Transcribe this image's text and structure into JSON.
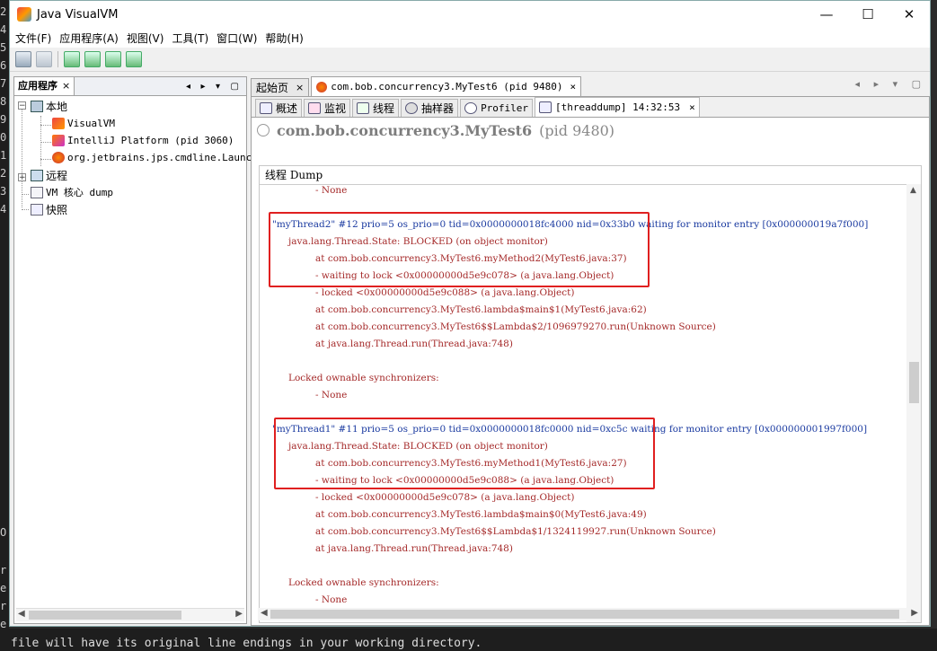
{
  "background": {
    "terminal_chars": [
      "2",
      "4",
      "5",
      "6",
      "7",
      "8",
      "9",
      "0",
      "1",
      "2",
      "3",
      "4",
      "O",
      "r",
      "e",
      "r",
      "e",
      "r"
    ],
    "bottom_text": "file will have its original line endings in your working directory."
  },
  "window": {
    "title": "Java VisualVM",
    "controls": {
      "minimize": "—",
      "maximize": "☐",
      "close": "✕"
    }
  },
  "menu": [
    "文件(F)",
    "应用程序(A)",
    "视图(V)",
    "工具(T)",
    "窗口(W)",
    "帮助(H)"
  ],
  "left_panel": {
    "tab_label": "应用程序",
    "tab_close": "×",
    "controls": "◂ ▸ ▾ ▢",
    "tree": {
      "local": "本地",
      "visualvm": "VisualVM",
      "intellij": "IntelliJ Platform (pid 3060)",
      "launcher": "org.jetbrains.jps.cmdline.Launcher",
      "remote": "远程",
      "core_dump": "VM 核心 dump",
      "snapshots": "快照"
    }
  },
  "doc_tabs": [
    {
      "label": "起始页",
      "close": "×"
    },
    {
      "label": "com.bob.concurrency3.MyTest6 (pid 9480)",
      "close": "×"
    }
  ],
  "doc_controls": "◂ ▸ ▾ ▢",
  "sub_tabs": [
    {
      "label": "概述"
    },
    {
      "label": "监视"
    },
    {
      "label": "线程"
    },
    {
      "label": "抽样器"
    },
    {
      "label": "Profiler"
    },
    {
      "label": "[threaddump] 14:32:53",
      "close": "×"
    }
  ],
  "process": {
    "name": "com.bob.concurrency3.MyTest6",
    "pid": "(pid 9480)"
  },
  "dump": {
    "header": "线程 Dump",
    "lines": [
      {
        "text": "- None",
        "indent": 2,
        "style": "red"
      },
      {
        "text": "",
        "indent": 0,
        "style": "red"
      },
      {
        "text": "\"myThread2\" #12 prio=5 os_prio=0 tid=0x0000000018fc4000 nid=0x33b0 waiting for monitor entry [0x000000019a7f000]",
        "indent": 0,
        "style": "blue"
      },
      {
        "text": "java.lang.Thread.State: BLOCKED (on object monitor)",
        "indent": 1,
        "style": "red"
      },
      {
        "text": "at com.bob.concurrency3.MyTest6.myMethod2(MyTest6.java:37)",
        "indent": 2,
        "style": "red"
      },
      {
        "text": "- waiting to lock <0x00000000d5e9c078> (a java.lang.Object)",
        "indent": 2,
        "style": "red"
      },
      {
        "text": "- locked <0x00000000d5e9c088> (a java.lang.Object)",
        "indent": 2,
        "style": "red"
      },
      {
        "text": "at com.bob.concurrency3.MyTest6.lambda$main$1(MyTest6.java:62)",
        "indent": 2,
        "style": "red"
      },
      {
        "text": "at com.bob.concurrency3.MyTest6$$Lambda$2/1096979270.run(Unknown Source)",
        "indent": 2,
        "style": "red"
      },
      {
        "text": "at java.lang.Thread.run(Thread.java:748)",
        "indent": 2,
        "style": "red"
      },
      {
        "text": "",
        "indent": 0,
        "style": "red"
      },
      {
        "text": "Locked ownable synchronizers:",
        "indent": 1,
        "style": "red"
      },
      {
        "text": "- None",
        "indent": 2,
        "style": "red"
      },
      {
        "text": "",
        "indent": 0,
        "style": "red"
      },
      {
        "text": "\"myThread1\" #11 prio=5 os_prio=0 tid=0x0000000018fc0000 nid=0xc5c waiting for monitor entry [0x000000001997f000]",
        "indent": 0,
        "style": "blue"
      },
      {
        "text": "java.lang.Thread.State: BLOCKED (on object monitor)",
        "indent": 1,
        "style": "red"
      },
      {
        "text": "at com.bob.concurrency3.MyTest6.myMethod1(MyTest6.java:27)",
        "indent": 2,
        "style": "red"
      },
      {
        "text": "- waiting to lock <0x00000000d5e9c088> (a java.lang.Object)",
        "indent": 2,
        "style": "red"
      },
      {
        "text": "- locked <0x00000000d5e9c078> (a java.lang.Object)",
        "indent": 2,
        "style": "red"
      },
      {
        "text": "at com.bob.concurrency3.MyTest6.lambda$main$0(MyTest6.java:49)",
        "indent": 2,
        "style": "red"
      },
      {
        "text": "at com.bob.concurrency3.MyTest6$$Lambda$1/1324119927.run(Unknown Source)",
        "indent": 2,
        "style": "red"
      },
      {
        "text": "at java.lang.Thread.run(Thread.java:748)",
        "indent": 2,
        "style": "red"
      },
      {
        "text": "",
        "indent": 0,
        "style": "red"
      },
      {
        "text": "Locked ownable synchronizers:",
        "indent": 1,
        "style": "red"
      },
      {
        "text": "- None",
        "indent": 2,
        "style": "red"
      }
    ]
  },
  "scroll": {
    "arrow_up": "▲",
    "arrow_down": "▼",
    "arrow_left": "◀",
    "arrow_right": "▶"
  },
  "colors": {
    "blocked_highlight": "#e02020",
    "thread_header": "#1a3aa0",
    "stack_text": "#a52a2a"
  }
}
